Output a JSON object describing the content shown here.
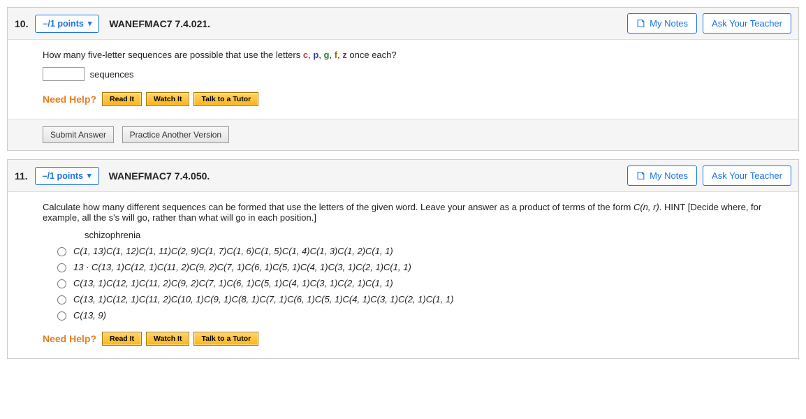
{
  "q10": {
    "number": "10.",
    "points": "–/1 points",
    "code": "WANEFMAC7 7.4.021.",
    "notes": "My Notes",
    "teacher": "Ask Your Teacher",
    "text_prefix": "How many five-letter sequences are possible that use the letters ",
    "letters": {
      "c": "c",
      "p": "p",
      "g": "g",
      "f": "f",
      "z": "z"
    },
    "text_suffix": " once each?",
    "seq_label": "sequences",
    "need_help": "Need Help?",
    "read_it": "Read It",
    "watch_it": "Watch It",
    "tutor": "Talk to a Tutor",
    "submit": "Submit Answer",
    "practice": "Practice Another Version"
  },
  "q11": {
    "number": "11.",
    "points": "–/1 points",
    "code": "WANEFMAC7 7.4.050.",
    "notes": "My Notes",
    "teacher": "Ask Your Teacher",
    "text1": "Calculate how many different sequences can be formed that use the letters of the given word. Leave your answer as a product of terms of the form ",
    "cnr": "C(n, r)",
    "hint_intro": ". HINT [Decide where, for example, all the s's will go, rather than what will go in each position.]",
    "word": "schizophrenia",
    "options": [
      "C(1, 13)C(1, 12)C(1, 11)C(2, 9)C(1, 7)C(1, 6)C(1, 5)C(1, 4)C(1, 3)C(1, 2)C(1, 1)",
      "13 · C(13, 1)C(12, 1)C(11, 2)C(9, 2)C(7, 1)C(6, 1)C(5, 1)C(4, 1)C(3, 1)C(2, 1)C(1, 1)",
      "C(13, 1)C(12, 1)C(11, 2)C(9, 2)C(7, 1)C(6, 1)C(5, 1)C(4, 1)C(3, 1)C(2, 1)C(1, 1)",
      "C(13, 1)C(12, 1)C(11, 2)C(10, 1)C(9, 1)C(8, 1)C(7, 1)C(6, 1)C(5, 1)C(4, 1)C(3, 1)C(2, 1)C(1, 1)",
      "C(13, 9)"
    ],
    "need_help": "Need Help?",
    "read_it": "Read It",
    "watch_it": "Watch It",
    "tutor": "Talk to a Tutor"
  }
}
